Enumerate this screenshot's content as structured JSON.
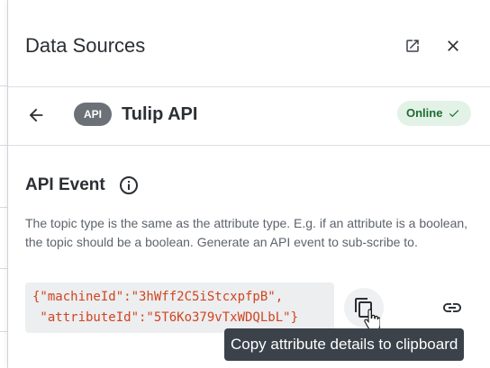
{
  "panel": {
    "title": "Data Sources"
  },
  "header_icons": {
    "popout": "open-in-new-icon",
    "close": "close-icon"
  },
  "source": {
    "badge": "API",
    "name": "Tulip API",
    "status": "Online",
    "status_icon": "checkmark-icon"
  },
  "section": {
    "title": "API Event",
    "info_icon": "info-icon",
    "description": "The topic type is the same as the attribute type. E.g. if an attribute is a boolean, the topic should be a boolean. Generate an API event to sub-scribe to.",
    "code_line1": "{\"machineId\":\"3hWff2C5iStcxpfpB\",",
    "code_line2": " \"attributeId\":\"5T6Ko379vTxWDQLbL\"}"
  },
  "actions": {
    "copy_icon": "copy-icon",
    "link_icon": "link-icon",
    "tooltip": "Copy attribute details to clipboard"
  },
  "colors": {
    "status_bg": "#e3f2e6",
    "status_text": "#1f6b34",
    "code_text": "#d0451f",
    "tooltip_bg": "#3b424a",
    "badge_bg": "#6c7178"
  }
}
